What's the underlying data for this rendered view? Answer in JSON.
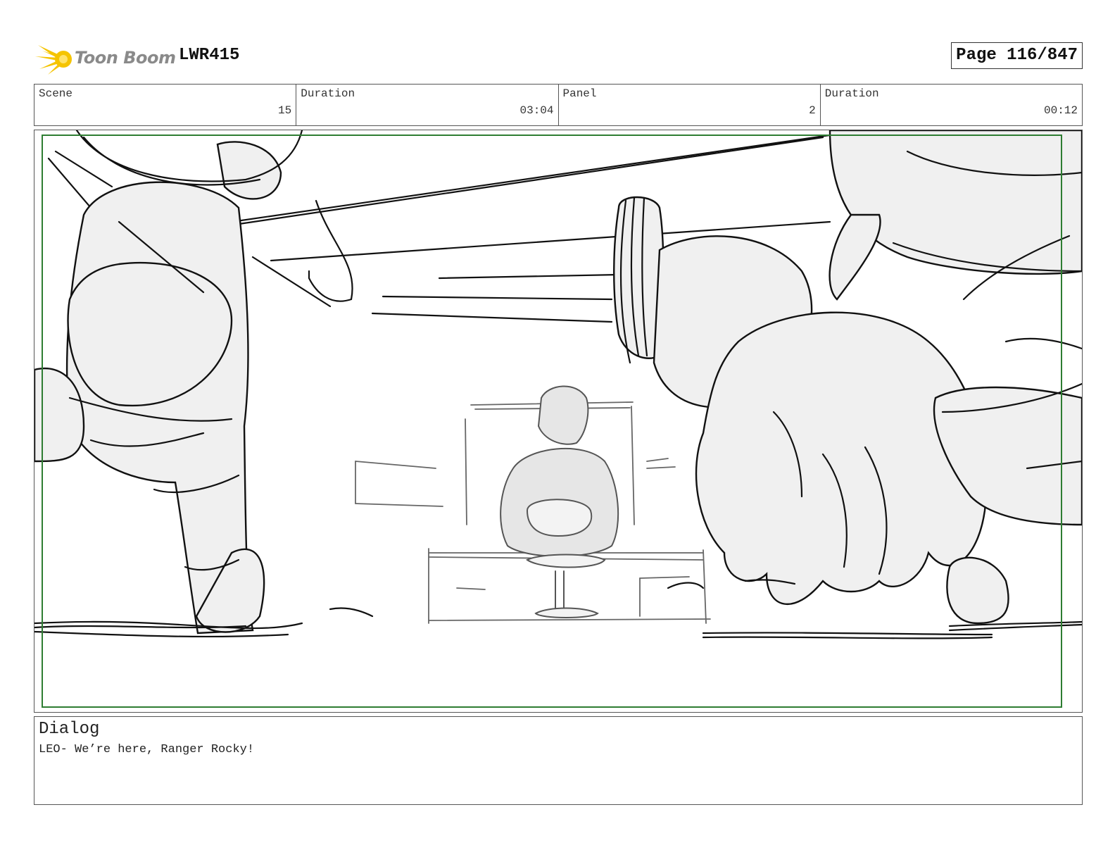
{
  "header": {
    "logo_text": "Toon Boom",
    "project_code": "LWR415",
    "page_label": "Page 116/847"
  },
  "meta": {
    "scene_label": "Scene",
    "scene_value": "15",
    "scene_duration_label": "Duration",
    "scene_duration_value": "03:04",
    "panel_label": "Panel",
    "panel_value": "2",
    "panel_duration_label": "Duration",
    "panel_duration_value": "00:12"
  },
  "dialog": {
    "title": "Dialog",
    "text": "LEO- We’re here, Ranger Rocky!"
  },
  "colors": {
    "safe_frame": "#2e7d32",
    "logo_burst": "#f5c400",
    "sketch_fill": "#f0f0f0",
    "sketch_line": "#111111"
  }
}
